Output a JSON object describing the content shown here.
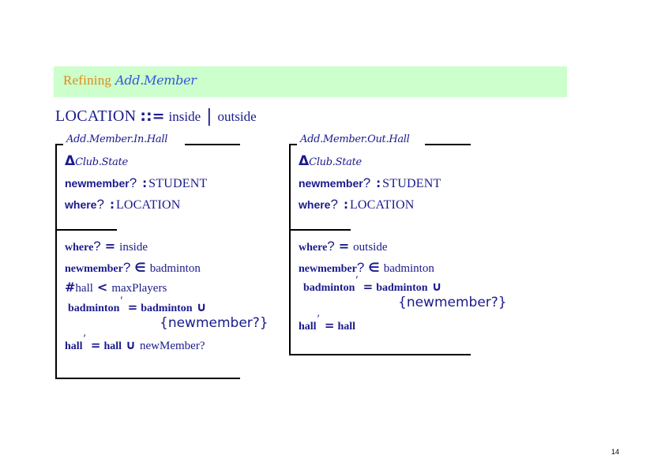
{
  "slide": {
    "page_number": "14",
    "background_color": "#ffffff"
  },
  "title": {
    "prefix": "Refining",
    "schema": "Add.Member",
    "banner_color": "#ccffcc",
    "prefix_color": "#e08a14",
    "schema_color": "#3355dd"
  },
  "free_type": {
    "name": "LOCATION",
    "operator": "::=",
    "value_1": "inside",
    "separator": "|",
    "value_2": "outside",
    "text_color": "#1a1a8c"
  },
  "schemas": [
    {
      "name": "Add.Member.In.Hall",
      "declarations": [
        {
          "delta": "Δ",
          "state": "Club.State"
        },
        {
          "var": "newmember",
          "decoration": "?",
          "colon": ":",
          "type": "STUDENT"
        },
        {
          "var": "where",
          "decoration": "?",
          "colon": ":",
          "type": "LOCATION"
        }
      ],
      "predicates": [
        {
          "lhs": "where",
          "decoration": "?",
          "op": "=",
          "rhs": "inside"
        },
        {
          "lhs": "newmember",
          "decoration": "?",
          "op": "∈",
          "rhs": "badminton"
        },
        {
          "hash": "#",
          "lhs": "hall",
          "op": "<",
          "rhs": "maxPlayers"
        },
        {
          "lhs": "badminton",
          "prime": "′",
          "op": "=",
          "rhs": "badminton",
          "union": "∪",
          "cont": "{newmember?}"
        },
        {
          "lhs": "hall",
          "prime": "′",
          "op": "=",
          "rhs": "hall",
          "union": "∪",
          "rhs2": "newMember?"
        }
      ]
    },
    {
      "name": "Add.Member.Out.Hall",
      "declarations": [
        {
          "delta": "Δ",
          "state": "Club.State"
        },
        {
          "var": "newmember",
          "decoration": "?",
          "colon": ":",
          "type": "STUDENT"
        },
        {
          "var": "where",
          "decoration": "?",
          "colon": ":",
          "type": "LOCATION"
        }
      ],
      "predicates": [
        {
          "lhs": "where",
          "decoration": "?",
          "op": "=",
          "rhs": "outside"
        },
        {
          "lhs": "newmember",
          "decoration": "?",
          "op": "∈",
          "rhs": "badminton"
        },
        {
          "lhs": "badminton",
          "prime": "′",
          "op": "=",
          "rhs": "badminton",
          "union": "∪",
          "cont": "{newmember?}"
        },
        {
          "lhs": "hall",
          "prime": "′",
          "op": "=",
          "rhs": "hall"
        }
      ]
    }
  ]
}
